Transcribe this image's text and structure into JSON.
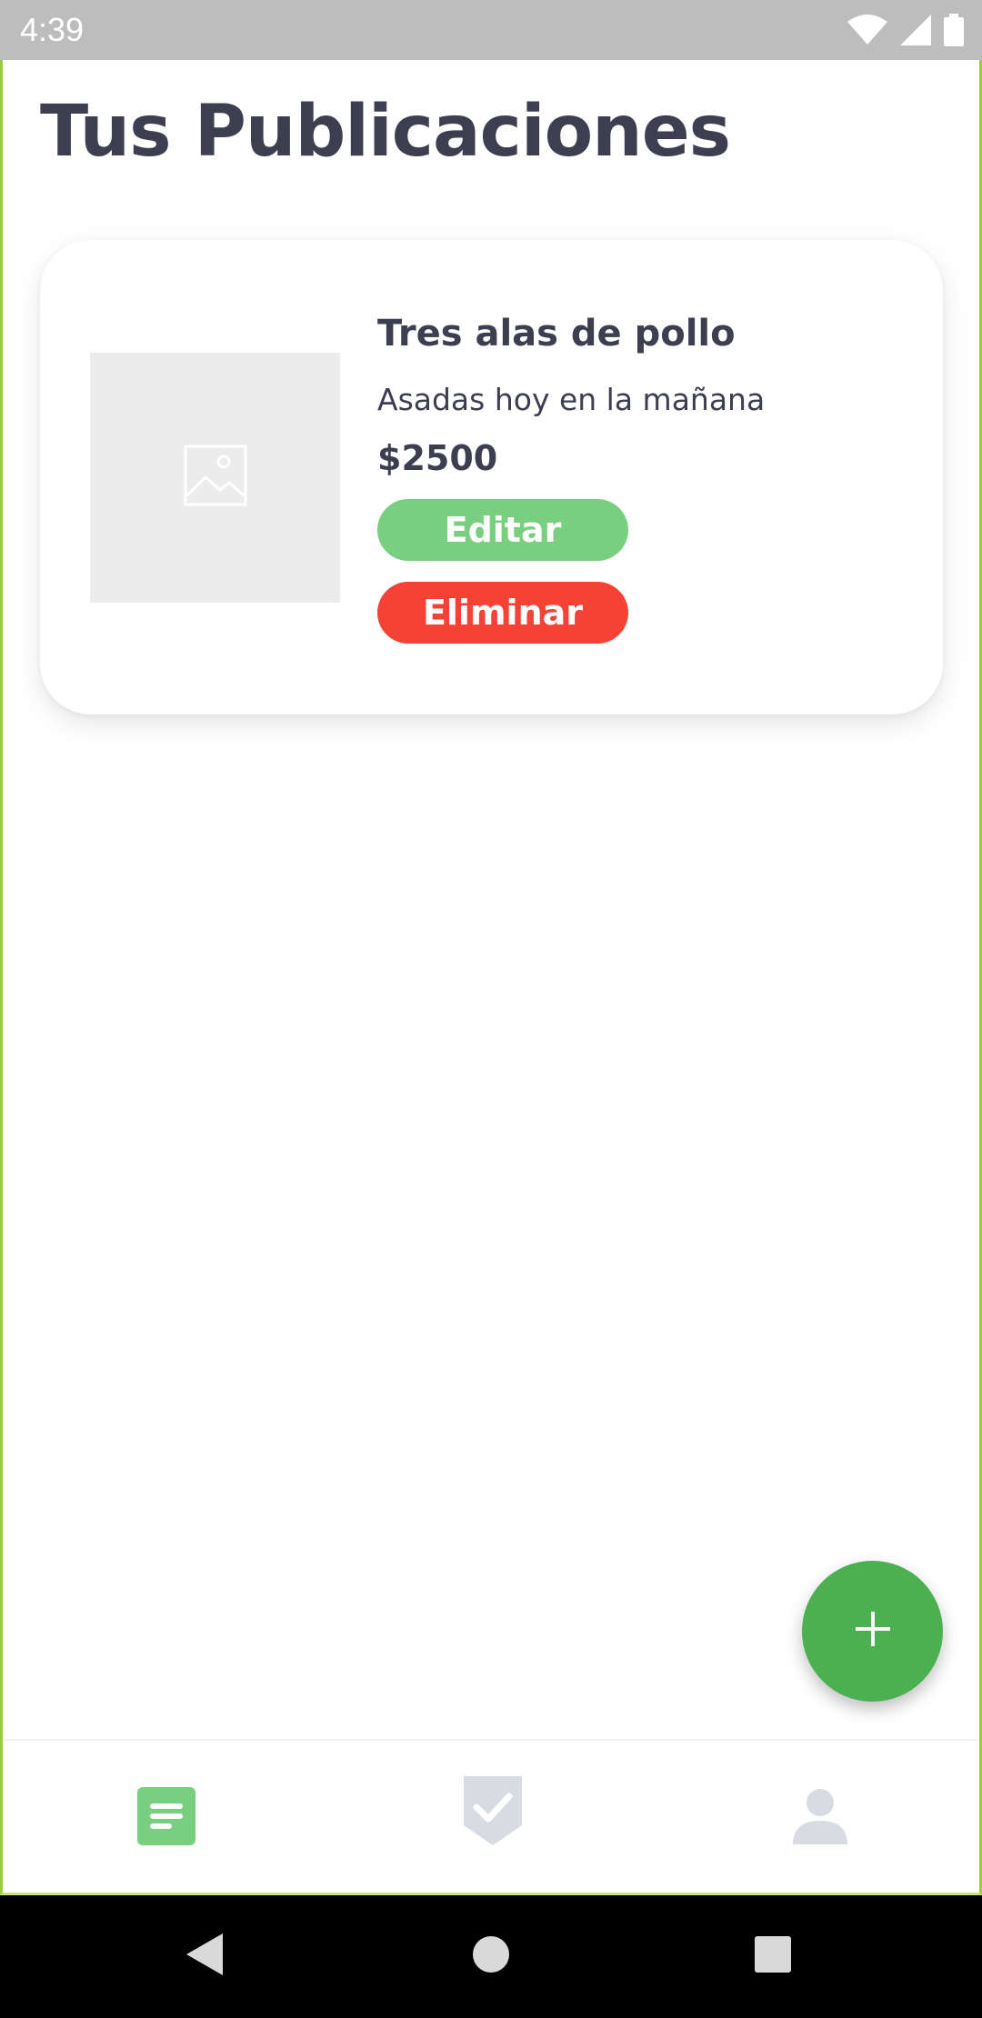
{
  "status_bar": {
    "time": "4:39",
    "icons": [
      "wifi-icon",
      "signal-icon",
      "battery-icon"
    ]
  },
  "page": {
    "title": "Tus Publicaciones"
  },
  "posts": [
    {
      "title": "Tres alas de pollo",
      "description": "Asadas hoy en la mañana",
      "price": "$2500",
      "image_icon": "image-placeholder-icon",
      "edit_label": "Editar",
      "delete_label": "Eliminar"
    }
  ],
  "fab": {
    "icon": "plus-icon"
  },
  "bottom_nav": {
    "items": [
      {
        "icon": "list-icon",
        "active": true
      },
      {
        "icon": "check-shield-icon",
        "active": false
      },
      {
        "icon": "person-icon",
        "active": false
      }
    ]
  },
  "system_nav": {
    "icons": [
      "back-icon",
      "home-icon",
      "recents-icon"
    ]
  },
  "colors": {
    "accent_green": "#4caf50",
    "edit_green": "#79cf7f",
    "delete_red": "#f44336",
    "text_dark": "#3d3f50",
    "inactive_icon": "#d9dbe3",
    "status_bar": "#bdbdbd"
  }
}
